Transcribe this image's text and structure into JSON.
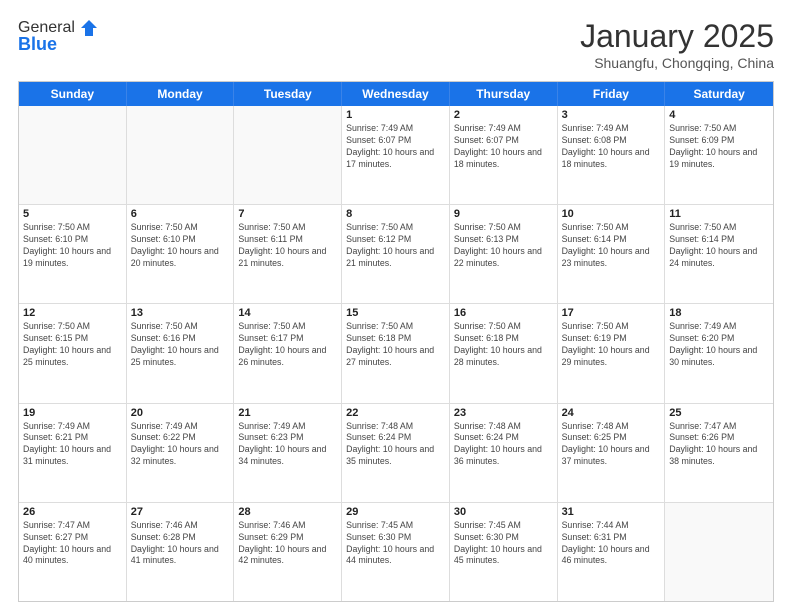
{
  "header": {
    "logo_line1": "General",
    "logo_line2": "Blue",
    "month": "January 2025",
    "location": "Shuangfu, Chongqing, China"
  },
  "days_of_week": [
    "Sunday",
    "Monday",
    "Tuesday",
    "Wednesday",
    "Thursday",
    "Friday",
    "Saturday"
  ],
  "weeks": [
    [
      {
        "num": "",
        "info": ""
      },
      {
        "num": "",
        "info": ""
      },
      {
        "num": "",
        "info": ""
      },
      {
        "num": "1",
        "info": "Sunrise: 7:49 AM\nSunset: 6:07 PM\nDaylight: 10 hours and 17 minutes."
      },
      {
        "num": "2",
        "info": "Sunrise: 7:49 AM\nSunset: 6:07 PM\nDaylight: 10 hours and 18 minutes."
      },
      {
        "num": "3",
        "info": "Sunrise: 7:49 AM\nSunset: 6:08 PM\nDaylight: 10 hours and 18 minutes."
      },
      {
        "num": "4",
        "info": "Sunrise: 7:50 AM\nSunset: 6:09 PM\nDaylight: 10 hours and 19 minutes."
      }
    ],
    [
      {
        "num": "5",
        "info": "Sunrise: 7:50 AM\nSunset: 6:10 PM\nDaylight: 10 hours and 19 minutes."
      },
      {
        "num": "6",
        "info": "Sunrise: 7:50 AM\nSunset: 6:10 PM\nDaylight: 10 hours and 20 minutes."
      },
      {
        "num": "7",
        "info": "Sunrise: 7:50 AM\nSunset: 6:11 PM\nDaylight: 10 hours and 21 minutes."
      },
      {
        "num": "8",
        "info": "Sunrise: 7:50 AM\nSunset: 6:12 PM\nDaylight: 10 hours and 21 minutes."
      },
      {
        "num": "9",
        "info": "Sunrise: 7:50 AM\nSunset: 6:13 PM\nDaylight: 10 hours and 22 minutes."
      },
      {
        "num": "10",
        "info": "Sunrise: 7:50 AM\nSunset: 6:14 PM\nDaylight: 10 hours and 23 minutes."
      },
      {
        "num": "11",
        "info": "Sunrise: 7:50 AM\nSunset: 6:14 PM\nDaylight: 10 hours and 24 minutes."
      }
    ],
    [
      {
        "num": "12",
        "info": "Sunrise: 7:50 AM\nSunset: 6:15 PM\nDaylight: 10 hours and 25 minutes."
      },
      {
        "num": "13",
        "info": "Sunrise: 7:50 AM\nSunset: 6:16 PM\nDaylight: 10 hours and 25 minutes."
      },
      {
        "num": "14",
        "info": "Sunrise: 7:50 AM\nSunset: 6:17 PM\nDaylight: 10 hours and 26 minutes."
      },
      {
        "num": "15",
        "info": "Sunrise: 7:50 AM\nSunset: 6:18 PM\nDaylight: 10 hours and 27 minutes."
      },
      {
        "num": "16",
        "info": "Sunrise: 7:50 AM\nSunset: 6:18 PM\nDaylight: 10 hours and 28 minutes."
      },
      {
        "num": "17",
        "info": "Sunrise: 7:50 AM\nSunset: 6:19 PM\nDaylight: 10 hours and 29 minutes."
      },
      {
        "num": "18",
        "info": "Sunrise: 7:49 AM\nSunset: 6:20 PM\nDaylight: 10 hours and 30 minutes."
      }
    ],
    [
      {
        "num": "19",
        "info": "Sunrise: 7:49 AM\nSunset: 6:21 PM\nDaylight: 10 hours and 31 minutes."
      },
      {
        "num": "20",
        "info": "Sunrise: 7:49 AM\nSunset: 6:22 PM\nDaylight: 10 hours and 32 minutes."
      },
      {
        "num": "21",
        "info": "Sunrise: 7:49 AM\nSunset: 6:23 PM\nDaylight: 10 hours and 34 minutes."
      },
      {
        "num": "22",
        "info": "Sunrise: 7:48 AM\nSunset: 6:24 PM\nDaylight: 10 hours and 35 minutes."
      },
      {
        "num": "23",
        "info": "Sunrise: 7:48 AM\nSunset: 6:24 PM\nDaylight: 10 hours and 36 minutes."
      },
      {
        "num": "24",
        "info": "Sunrise: 7:48 AM\nSunset: 6:25 PM\nDaylight: 10 hours and 37 minutes."
      },
      {
        "num": "25",
        "info": "Sunrise: 7:47 AM\nSunset: 6:26 PM\nDaylight: 10 hours and 38 minutes."
      }
    ],
    [
      {
        "num": "26",
        "info": "Sunrise: 7:47 AM\nSunset: 6:27 PM\nDaylight: 10 hours and 40 minutes."
      },
      {
        "num": "27",
        "info": "Sunrise: 7:46 AM\nSunset: 6:28 PM\nDaylight: 10 hours and 41 minutes."
      },
      {
        "num": "28",
        "info": "Sunrise: 7:46 AM\nSunset: 6:29 PM\nDaylight: 10 hours and 42 minutes."
      },
      {
        "num": "29",
        "info": "Sunrise: 7:45 AM\nSunset: 6:30 PM\nDaylight: 10 hours and 44 minutes."
      },
      {
        "num": "30",
        "info": "Sunrise: 7:45 AM\nSunset: 6:30 PM\nDaylight: 10 hours and 45 minutes."
      },
      {
        "num": "31",
        "info": "Sunrise: 7:44 AM\nSunset: 6:31 PM\nDaylight: 10 hours and 46 minutes."
      },
      {
        "num": "",
        "info": ""
      }
    ]
  ]
}
